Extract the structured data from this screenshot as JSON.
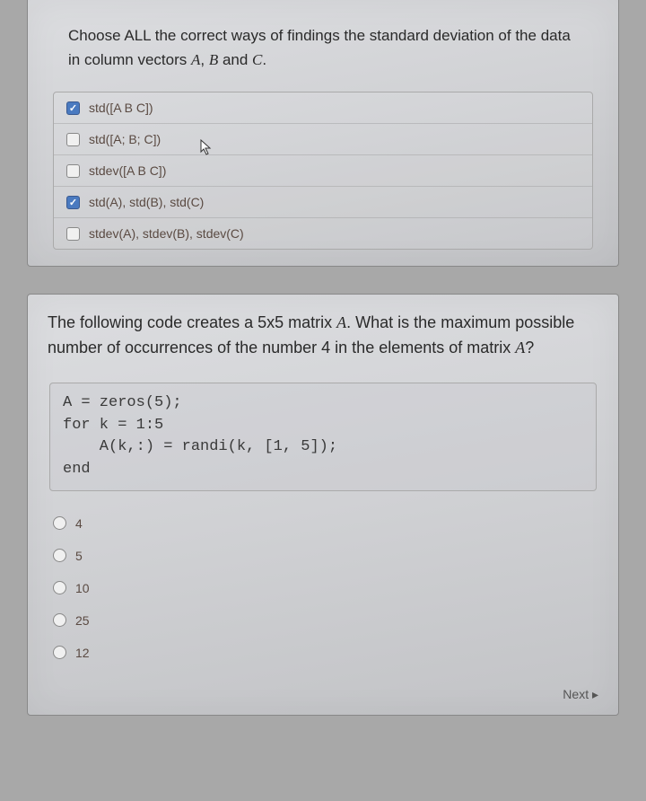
{
  "q1": {
    "prompt_pre": "Choose ALL the correct ways of findings the standard deviation of the data in column vectors ",
    "var_a": "A",
    "sep1": ", ",
    "var_b": "B",
    "sep2": " and ",
    "var_c": "C",
    "prompt_post": ".",
    "options": [
      {
        "label": "std([A B C])",
        "checked": true
      },
      {
        "label": "std([A; B; C])",
        "checked": false
      },
      {
        "label": "stdev([A B C])",
        "checked": false
      },
      {
        "label": "std(A), std(B), std(C)",
        "checked": true
      },
      {
        "label": "stdev(A), stdev(B), stdev(C)",
        "checked": false
      }
    ]
  },
  "q2": {
    "prompt_pre": "The following code creates a 5x5 matrix ",
    "var_a1": "A",
    "prompt_mid": ". What is the maximum possible number of occurrences of the number 4 in the elements of matrix ",
    "var_a2": "A",
    "prompt_post": "?",
    "code": "A = zeros(5);\nfor k = 1:5\n    A(k,:) = randi(k, [1, 5]);\nend",
    "options": [
      {
        "label": "4"
      },
      {
        "label": "5"
      },
      {
        "label": "10"
      },
      {
        "label": "25"
      },
      {
        "label": "12"
      }
    ]
  },
  "footer": {
    "next_label": "Next ▸"
  }
}
